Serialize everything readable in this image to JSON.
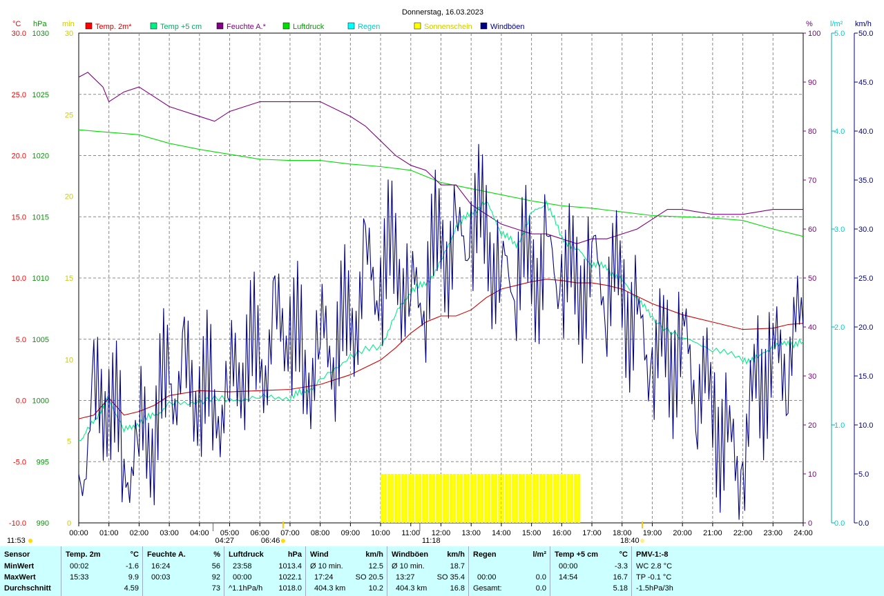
{
  "title": "Donnerstag, 16.03.2023",
  "legend": [
    {
      "label": "Temp. 2m*",
      "color": "#ff0000"
    },
    {
      "label": "Temp +5 cm",
      "color": "#00ee88"
    },
    {
      "label": "Feuchte A.*",
      "color": "#800080"
    },
    {
      "label": "Luftdruck",
      "color": "#00dd00"
    },
    {
      "label": "Regen",
      "color": "#00ffff"
    },
    {
      "label": "Sonnenschein",
      "color": "#ffff00"
    },
    {
      "label": "Windböen",
      "color": "#000080"
    }
  ],
  "axes": {
    "temp_unit": "°C",
    "temp_ticks": [
      "30.0",
      "25.0",
      "20.0",
      "15.0",
      "10.0",
      "5.0",
      "0.0",
      "-5.0",
      "-10.0"
    ],
    "hpa_unit": "hPa",
    "hpa_ticks": [
      "1030",
      "1025",
      "1020",
      "1015",
      "1010",
      "1005",
      "1000",
      "995",
      "990"
    ],
    "min_unit": "min",
    "min_ticks": [
      "30",
      "25",
      "20",
      "15",
      "10",
      "5",
      "0"
    ],
    "pct_unit": "%",
    "pct_ticks": [
      "100",
      "90",
      "80",
      "70",
      "60",
      "50",
      "40",
      "30",
      "20",
      "10",
      "0"
    ],
    "rain_unit": "l/m²",
    "rain_ticks": [
      "5.0",
      "4.0",
      "3.0",
      "2.0",
      "1.0",
      "0.0"
    ],
    "wind_unit": "km/h",
    "wind_ticks": [
      "50.0",
      "45.0",
      "40.0",
      "35.0",
      "30.0",
      "25.0",
      "20.0",
      "15.0",
      "10.0",
      "5.0",
      "0.0"
    ],
    "x_ticks": [
      "00:00",
      "01:00",
      "02:00",
      "03:00",
      "04:00",
      "05:00",
      "06:00",
      "07:00",
      "08:00",
      "09:00",
      "10:00",
      "11:00",
      "12:00",
      "13:00",
      "14:00",
      "15:00",
      "16:00",
      "17:00",
      "18:00",
      "19:00",
      "20:00",
      "21:00",
      "22:00",
      "23:00",
      "24:00"
    ]
  },
  "markers": {
    "time_now": "11:53",
    "moonrise": "04:27",
    "sunrise": "06:46",
    "noon": "11:18",
    "sunset": "18:40"
  },
  "chart_data": {
    "type": "line",
    "title": "Donnerstag, 16.03.2023",
    "x_unit": "hours",
    "xlim": [
      0,
      24
    ],
    "series": [
      {
        "name": "Temp. 2m*",
        "unit": "°C",
        "ylim": [
          -10,
          30
        ],
        "x": [
          0,
          0.5,
          1,
          1.5,
          2,
          2.5,
          3,
          4,
          5,
          6,
          7,
          8,
          9,
          10,
          10.5,
          11,
          11.5,
          12,
          12.5,
          13,
          13.5,
          14,
          14.5,
          15,
          15.5,
          16,
          16.5,
          17,
          17.5,
          18,
          18.5,
          19,
          20,
          21,
          22,
          23,
          23.5,
          24
        ],
        "y": [
          -1.5,
          -1.2,
          0.2,
          -1.2,
          -0.9,
          -0.4,
          0.4,
          0.8,
          0.7,
          0.8,
          0.9,
          1.3,
          2.1,
          3.3,
          4.3,
          5.5,
          6.4,
          6.9,
          6.9,
          7.4,
          8.4,
          9.1,
          9.4,
          9.7,
          9.9,
          9.8,
          9.6,
          9.6,
          9.4,
          9.1,
          8.5,
          7.9,
          7.0,
          6.4,
          5.8,
          5.9,
          6.2,
          6.3
        ]
      },
      {
        "name": "Temp +5 cm",
        "unit": "°C",
        "ylim": [
          -10,
          30
        ],
        "x": [
          0,
          0.3,
          0.8,
          1,
          1.5,
          2,
          2.5,
          3,
          4,
          5,
          6,
          7,
          7.5,
          8,
          9,
          10,
          10.5,
          11,
          11.5,
          12,
          12.5,
          13,
          13.5,
          14,
          14.5,
          15,
          15.5,
          16,
          16.5,
          17,
          17.5,
          18,
          18.5,
          19,
          20,
          21,
          22,
          22.5,
          23,
          23.5,
          24
        ],
        "y": [
          -3.3,
          -2.5,
          -0.5,
          0.2,
          -2.5,
          -1.8,
          -1.2,
          -0.4,
          0.0,
          0.1,
          0.2,
          0.3,
          0.7,
          1.5,
          3.7,
          4.4,
          7.0,
          9.0,
          9.5,
          11.2,
          14.2,
          15.3,
          16.2,
          13.8,
          12.6,
          15.2,
          16.2,
          13.3,
          12.3,
          11.2,
          10.8,
          9.7,
          8.4,
          6.7,
          5.0,
          4.3,
          3.3,
          3.4,
          4.5,
          4.6,
          4.8
        ]
      },
      {
        "name": "Feuchte A.*",
        "unit": "%",
        "ylim": [
          0,
          100
        ],
        "x": [
          0,
          0.3,
          0.8,
          1,
          1.5,
          2,
          2.5,
          3,
          4,
          4.5,
          5,
          6,
          7,
          8,
          9,
          9.5,
          10,
          10.5,
          11,
          11.5,
          12,
          12.5,
          13,
          13.5,
          14,
          14.5,
          15,
          15.5,
          16,
          16.5,
          17,
          17.5,
          18,
          18.5,
          19,
          19.5,
          20,
          21,
          22,
          23,
          23.5,
          24
        ],
        "y": [
          91,
          92,
          89,
          86,
          88,
          89,
          87,
          85,
          83,
          82,
          84,
          86,
          86,
          86,
          83,
          81,
          78,
          75,
          73,
          72,
          69,
          69,
          65,
          63,
          61,
          60,
          59,
          59,
          58,
          57,
          58,
          58,
          59,
          60,
          62,
          64,
          64,
          63,
          63,
          64,
          64,
          64
        ]
      },
      {
        "name": "Luftdruck",
        "unit": "hPa",
        "ylim": [
          990,
          1030
        ],
        "x": [
          0,
          1,
          2,
          3,
          4,
          5,
          6,
          7,
          8,
          9,
          10,
          11,
          12,
          13,
          14,
          15,
          16,
          17,
          18,
          19,
          20,
          21,
          22,
          23,
          24
        ],
        "y": [
          1022.1,
          1021.9,
          1021.7,
          1021.0,
          1020.5,
          1020.1,
          1019.7,
          1019.6,
          1019.6,
          1019.3,
          1019.1,
          1018.8,
          1017.8,
          1017.3,
          1016.8,
          1016.3,
          1015.9,
          1015.7,
          1015.4,
          1015.1,
          1015.0,
          1014.9,
          1014.7,
          1014.0,
          1013.4
        ]
      },
      {
        "name": "Regen",
        "unit": "l/m²",
        "ylim": [
          0,
          5
        ],
        "x": [
          0,
          24
        ],
        "y": [
          0.0,
          0.0
        ]
      },
      {
        "name": "Sonnenschein",
        "unit": "min",
        "ylim": [
          0,
          30
        ],
        "x": [
          10.0,
          16.6
        ],
        "y": [
          3,
          3
        ]
      },
      {
        "name": "Windböen",
        "unit": "km/h",
        "ylim": [
          0,
          50
        ],
        "x": [
          0,
          0.5,
          1,
          1.5,
          2,
          2.5,
          3,
          3.5,
          4,
          4.5,
          5,
          5.5,
          6,
          6.5,
          7,
          7.5,
          8,
          8.5,
          9,
          9.5,
          10,
          10.5,
          11,
          11.5,
          12,
          12.5,
          13,
          13.5,
          14,
          14.5,
          15,
          15.5,
          16,
          16.5,
          17,
          17.5,
          18,
          18.5,
          19,
          19.5,
          20,
          20.5,
          21,
          21.5,
          22,
          22.5,
          23,
          23.5,
          24
        ],
        "y": [
          5,
          11,
          14,
          6,
          8,
          10,
          15,
          14,
          14,
          12,
          13,
          18,
          16,
          19,
          21,
          15,
          18,
          19,
          20,
          25,
          25,
          28,
          22,
          25,
          29,
          27,
          31,
          30,
          24,
          27,
          26,
          26,
          26,
          24,
          26,
          25,
          24,
          19,
          17,
          17,
          18,
          15,
          12,
          7,
          6,
          15,
          16,
          18,
          20
        ]
      }
    ]
  },
  "stats": {
    "col0": {
      "header": "Sensor",
      "rows": [
        "MinWert",
        "MaxWert",
        "Durchschnitt"
      ]
    },
    "col1": {
      "header": "Temp. 2m",
      "unit": "°C",
      "rows": [
        [
          "00:02",
          "-1.6"
        ],
        [
          "15:33",
          "9.9"
        ],
        [
          "",
          "4.59"
        ]
      ]
    },
    "col2": {
      "header": "Feuchte A.",
      "unit": "%",
      "rows": [
        [
          "16:24",
          "56"
        ],
        [
          "00:03",
          "92"
        ],
        [
          "",
          "73"
        ]
      ]
    },
    "col3": {
      "header": "Luftdruck",
      "unit": "hPa",
      "rows": [
        [
          "23:58",
          "1013.4"
        ],
        [
          "00:00",
          "1022.1"
        ],
        [
          "^1.1hPa/h",
          "1018.0"
        ]
      ]
    },
    "col4": {
      "header": "Wind",
      "unit": "km/h",
      "rows": [
        [
          "Ø 10 min.",
          "12.5"
        ],
        [
          "17:24",
          "SO 20.5"
        ],
        [
          "404.3 km",
          "10.2"
        ]
      ]
    },
    "col5": {
      "header": "Windböen",
      "unit": "km/h",
      "rows": [
        [
          "Ø 10 min.",
          "18.7"
        ],
        [
          "13:27",
          "SO 35.4"
        ],
        [
          "404.3 km",
          "16.8"
        ]
      ]
    },
    "col6": {
      "header": "Regen",
      "unit": "l/m²",
      "rows": [
        [
          "",
          ""
        ],
        [
          "00:00",
          "0.0"
        ],
        [
          "Gesamt:",
          "0.0"
        ]
      ]
    },
    "col7": {
      "header": "Temp +5 cm",
      "unit": "°C",
      "rows": [
        [
          "00:00",
          "-3.3"
        ],
        [
          "14:54",
          "16.7"
        ],
        [
          "",
          "5.18"
        ]
      ]
    },
    "col8": {
      "header": "PMV-1:-8",
      "rows": [
        "WC 2.8 °C",
        "TP -0.1 °C",
        "-1.5hPa/3h"
      ]
    }
  }
}
